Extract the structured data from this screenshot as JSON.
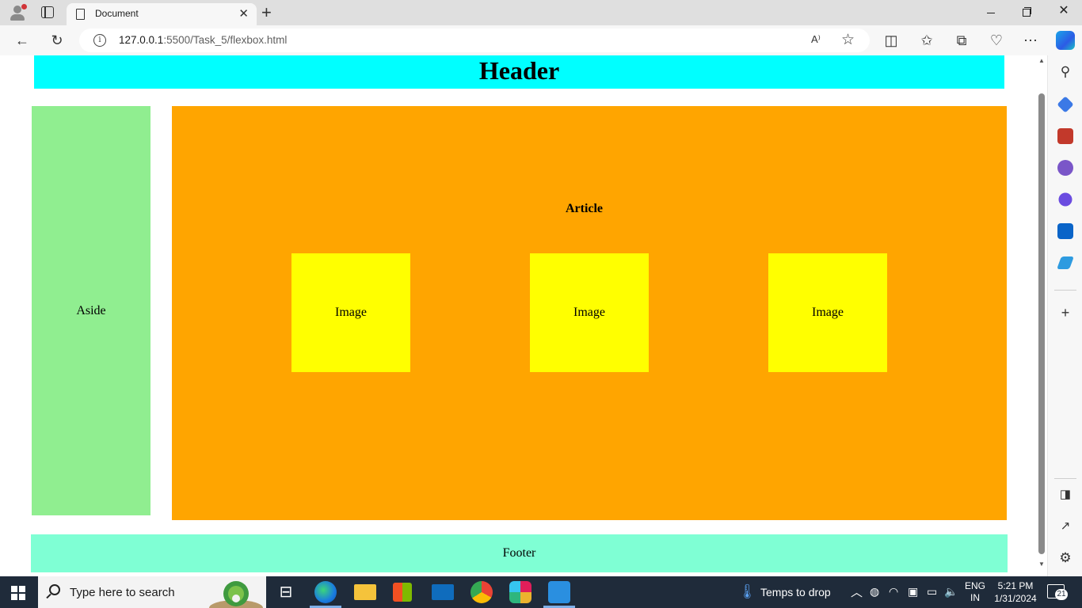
{
  "browser": {
    "tab_title": "Document",
    "url_host": "127.0.0.1",
    "url_path": ":5500/Task_5/flexbox.html",
    "read_aloud_label": "A⁾"
  },
  "page": {
    "header": "Header",
    "aside": "Aside",
    "article_title": "Article",
    "images": [
      "Image",
      "Image",
      "Image"
    ],
    "footer": "Footer"
  },
  "taskbar": {
    "search_placeholder": "Type here to search",
    "weather": "Temps to drop",
    "language": "ENG",
    "region": "IN",
    "time": "5:21 PM",
    "date": "1/31/2024",
    "notifications": "21"
  },
  "colors": {
    "header": "#00ffff",
    "aside": "#90ee90",
    "article": "#ffa500",
    "image": "#ffff00",
    "footer": "#7fffd4"
  }
}
